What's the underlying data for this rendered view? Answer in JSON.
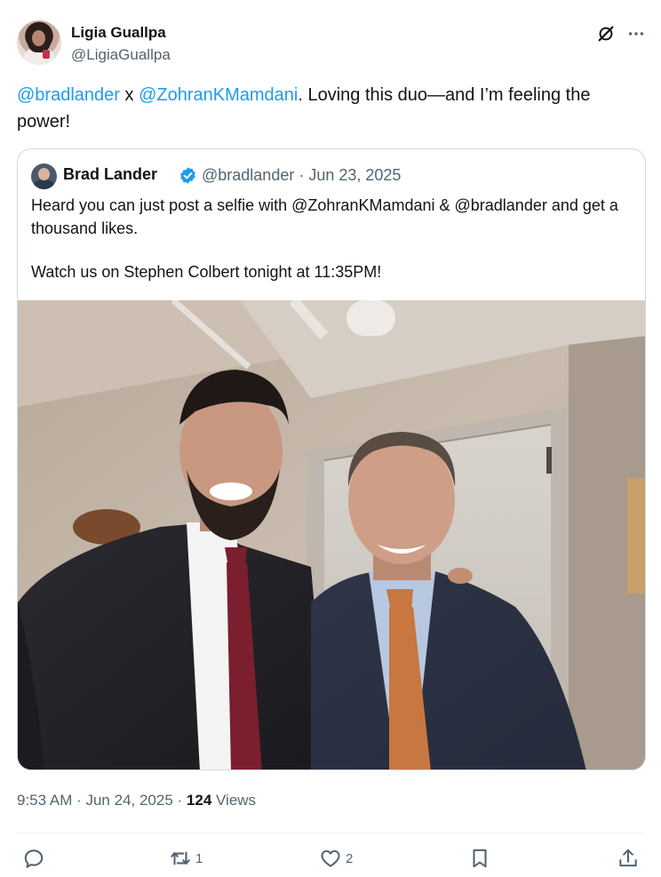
{
  "author": {
    "display_name": "Ligia Guallpa",
    "handle": "@LigiaGuallpa"
  },
  "tweet": {
    "mention_1": "@bradlander",
    "connector": " x ",
    "mention_2": "@ZohranKMamdani",
    "rest": ". Loving this duo—and I’m feeling the power!"
  },
  "quoted": {
    "display_name": "Brad Lander",
    "meta": "@bradlander · Jun 23, 2025",
    "line_1": "Heard you can just post a selfie with @ZohranKMamdani & @bradlander and get a thousand likes.",
    "line_2": "Watch us on Stephen Colbert tonight at 11:35PM!",
    "verified_color": "#1d9bf0"
  },
  "footer": {
    "time_date": "9:53 AM · Jun 24, 2025 · ",
    "views_count": "124",
    "views_label": " Views"
  },
  "actions": {
    "replies": "",
    "reposts": "1",
    "likes": "2"
  },
  "colors": {
    "accent": "#1d9bf0",
    "text": "#0f1419",
    "muted": "#536471",
    "border": "#cfd9de"
  },
  "icons": [
    "grok-icon",
    "more-icon",
    "verified-icon",
    "reply-icon",
    "repost-icon",
    "like-icon",
    "bookmark-icon",
    "share-icon"
  ]
}
